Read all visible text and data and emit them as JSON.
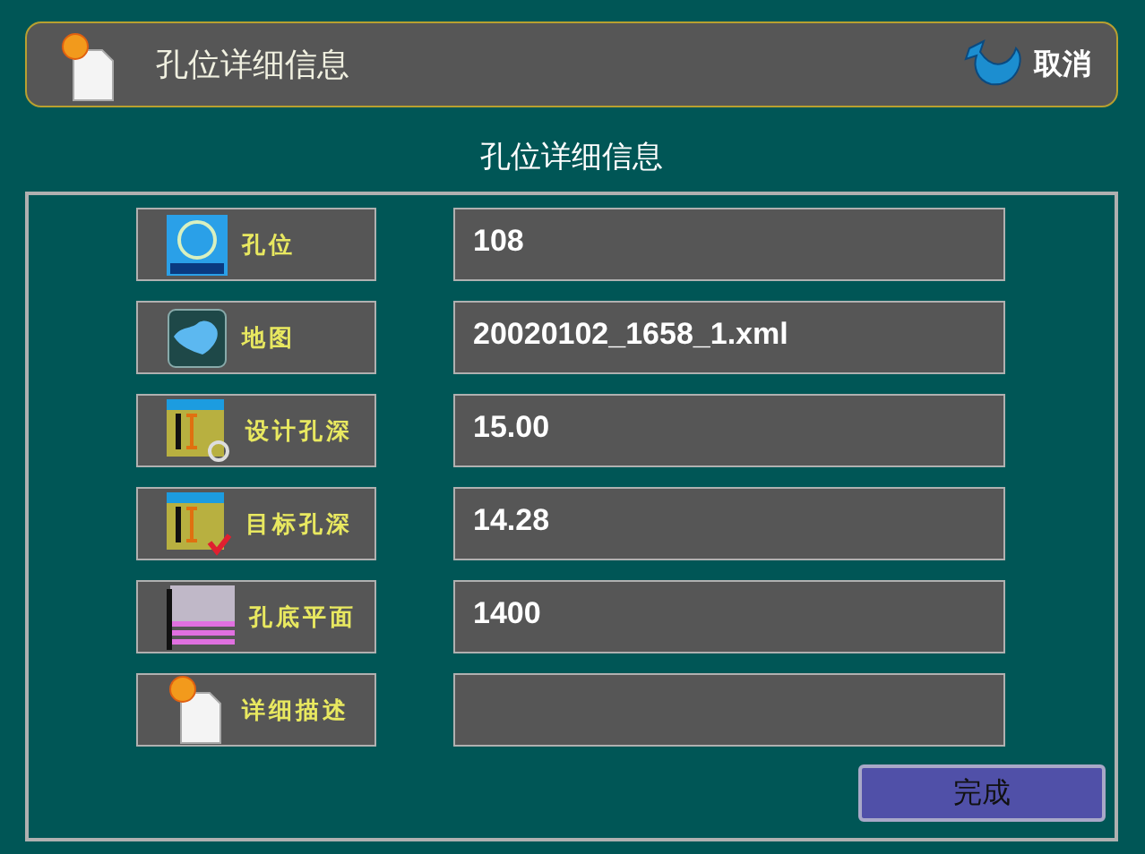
{
  "header": {
    "title": "孔位详细信息",
    "cancel_button": "取消"
  },
  "panel_title": "孔位详细信息",
  "fields": [
    {
      "kind": "hole",
      "label": "孔位",
      "value": "108"
    },
    {
      "kind": "map",
      "label": "地图",
      "value": "20020102_1658_1.xml"
    },
    {
      "kind": "design-depth",
      "label": "设计孔深",
      "value": "15.00"
    },
    {
      "kind": "target-depth",
      "label": "目标孔深",
      "value": "14.28"
    },
    {
      "kind": "bottom",
      "label": "孔底平面",
      "value": "1400"
    },
    {
      "kind": "doc",
      "label": "详细描述"
    }
  ],
  "done_button": "完成"
}
